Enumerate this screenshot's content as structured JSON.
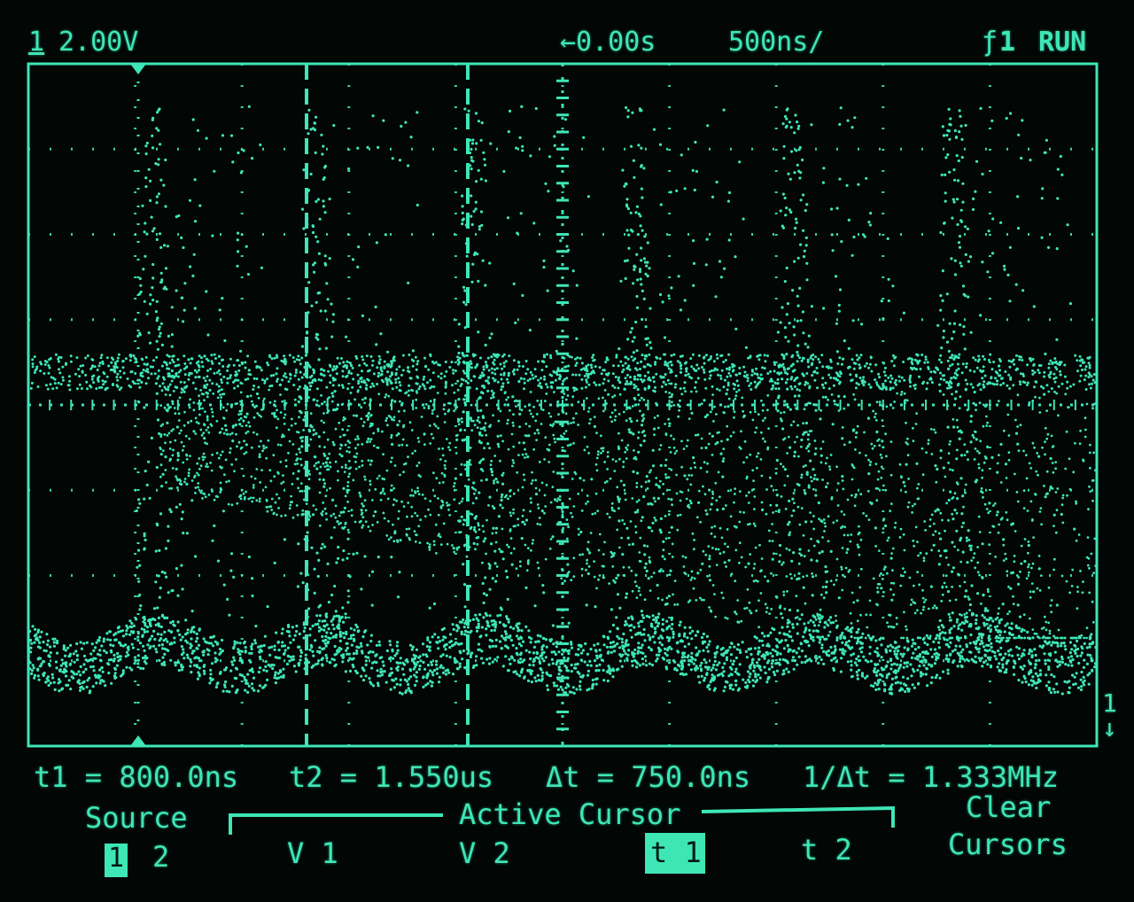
{
  "status_bar": {
    "channel_number": "1",
    "volts_per_div": "2.00V",
    "delay": "←0.00s",
    "time_per_div": "500ns/",
    "trigger_source": "1",
    "run_state": "RUN"
  },
  "measurements": {
    "t1": "t1 = 800.0ns",
    "t2": "t2 = 1.550us",
    "delta_t": "Δt = 750.0ns",
    "inv_delta_t": "1/Δt = 1.333MHz"
  },
  "softkeys": {
    "source_label": "Source",
    "source_option_1": "1",
    "source_option_2": "2",
    "active_cursor_label": "Active Cursor",
    "v1": "V 1",
    "v2": "V 2",
    "t1": "t 1",
    "t2": "t 2",
    "clear_line1": "Clear",
    "clear_line2": "Cursors"
  },
  "colors": {
    "trace": "#3ee6b6",
    "background": "#020604",
    "graticule": "#3ee6b6"
  }
}
